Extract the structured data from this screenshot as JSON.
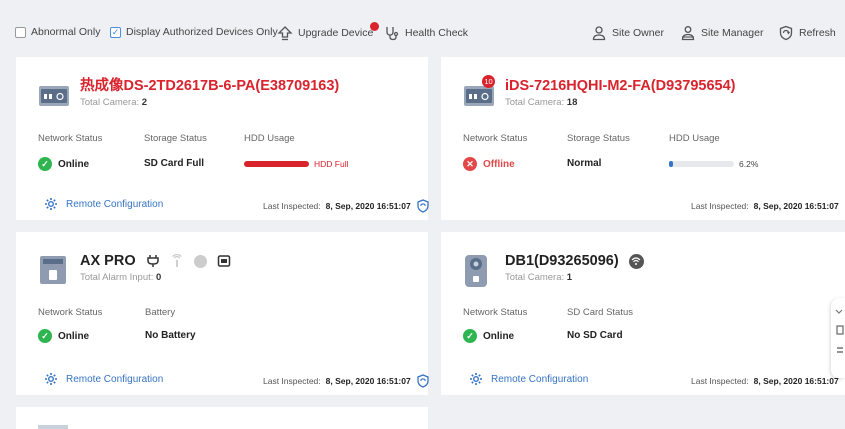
{
  "toolbar": {
    "abnormal_only": "Abnormal Only",
    "display_authorized": "Display Authorized Devices Only",
    "upgrade_device": "Upgrade Device",
    "health_check": "Health Check",
    "site_owner": "Site Owner",
    "site_manager": "Site Manager",
    "refresh": "Refresh",
    "abnormal_checked": false,
    "authorized_checked": true
  },
  "cards": [
    {
      "name": "热成像DS-2TD2617B-6-PA(E38709163)",
      "sub_label": "Total Camera:",
      "sub_value": "2",
      "col1_label": "Network Status",
      "col1_value": "Online",
      "col2_label": "Storage Status",
      "col2_value": "SD Card Full",
      "col3_label": "HDD Usage",
      "bar_text": "HDD Full",
      "bar_fraction": 1.0,
      "remote": "Remote Configuration",
      "last_label": "Last Inspected:",
      "last_value": "8, Sep, 2020 16:51:07"
    },
    {
      "name": "iDS-7216HQHI-M2-FA(D93795654)",
      "badge": "10",
      "sub_label": "Total Camera:",
      "sub_value": "18",
      "col1_label": "Network Status",
      "col1_value": "Offline",
      "col2_label": "Storage Status",
      "col2_value": "Normal",
      "col3_label": "HDD Usage",
      "bar_text": "6.2%",
      "bar_fraction": 0.062,
      "last_label": "Last Inspected:",
      "last_value": "8, Sep, 2020 16:51:07"
    },
    {
      "name": "AX PRO",
      "sub_label": "Total Alarm Input:",
      "sub_value": "0",
      "col1_label": "Network Status",
      "col1_value": "Online",
      "col2_label": "Battery",
      "col2_value": "No Battery",
      "remote": "Remote Configuration",
      "last_label": "Last Inspected:",
      "last_value": "8, Sep, 2020 16:51:07"
    },
    {
      "name": "DB1(D93265096)",
      "sub_label": "Total Camera:",
      "sub_value": "1",
      "col1_label": "Network Status",
      "col1_value": "Online",
      "col2_label": "SD Card Status",
      "col2_value": "No SD Card",
      "remote": "Remote Configuration",
      "last_label": "Last Inspected:",
      "last_value": "8, Sep, 2020 16:51:07"
    }
  ],
  "colors": {
    "accent": "#3674c4",
    "error": "#d9232d",
    "ok": "#2fb54f",
    "bar_blue": "#3674c4"
  }
}
